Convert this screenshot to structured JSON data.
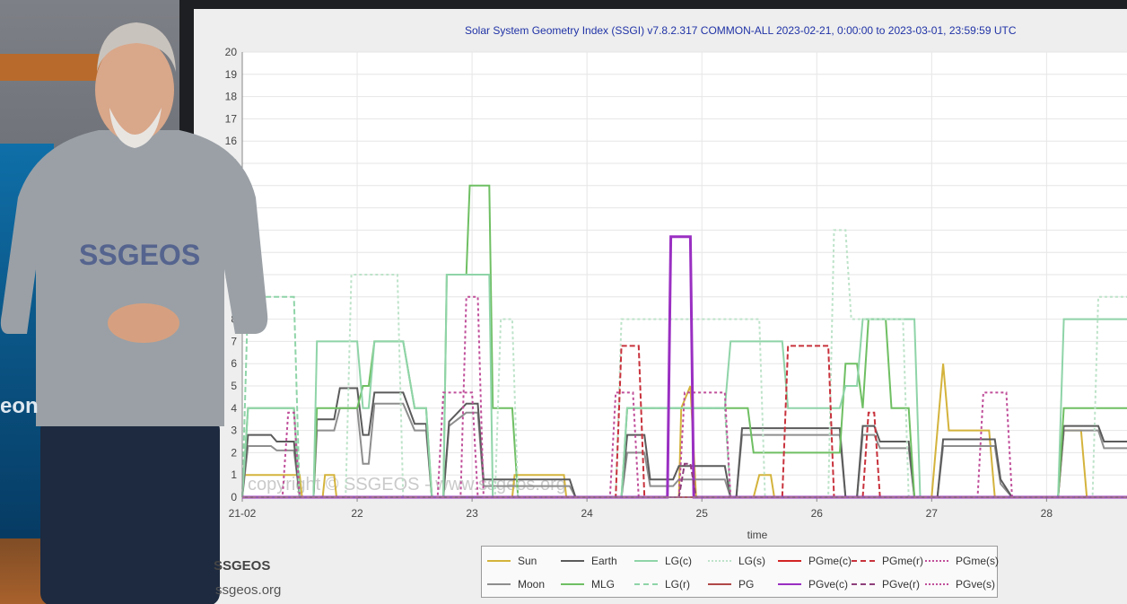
{
  "footer": {
    "name": "SSGEOS",
    "site": "ssgeos.org"
  },
  "shirt_logo": "SSGEOS",
  "side_screen_text": "eon",
  "chart_data": {
    "type": "line",
    "title": "Solar System Geometry Index (SSGI) v7.8.2.317 COMMON-ALL 2023-02-21,  0:00:00 to 2023-03-01, 23:59:59 UTC",
    "xlabel": "time",
    "ylabel": "",
    "x_tick_labels": [
      "21-02",
      "22",
      "23",
      "24",
      "25",
      "26",
      "27",
      "28"
    ],
    "x_tick_values": [
      0,
      1,
      2,
      3,
      4,
      5,
      6,
      7
    ],
    "xlim": [
      0,
      7.7
    ],
    "ylim": [
      0,
      20
    ],
    "y_ticks": [
      0,
      1,
      2,
      3,
      4,
      5,
      6,
      7,
      8,
      9,
      10,
      11,
      12,
      13,
      14,
      15,
      16,
      17,
      18,
      19,
      20
    ],
    "grid": true,
    "watermark": "copyright © SSGEOS - www.ssgeos.org",
    "legend_position": "bottom",
    "series": [
      {
        "name": "Sun",
        "color": "#d4b33c",
        "dash": "solid",
        "points": [
          [
            0,
            1
          ],
          [
            0.5,
            1
          ],
          [
            0.52,
            0
          ],
          [
            0.7,
            0
          ],
          [
            0.72,
            1
          ],
          [
            0.8,
            1
          ],
          [
            0.82,
            0
          ],
          [
            2.35,
            0
          ],
          [
            2.37,
            1
          ],
          [
            2.8,
            1
          ],
          [
            2.82,
            0
          ],
          [
            3.8,
            0
          ],
          [
            3.82,
            4
          ],
          [
            3.9,
            5
          ],
          [
            3.95,
            0
          ],
          [
            4.45,
            0
          ],
          [
            4.5,
            1
          ],
          [
            4.6,
            1
          ],
          [
            4.63,
            0
          ],
          [
            6.0,
            0
          ],
          [
            6.05,
            3
          ],
          [
            6.1,
            6
          ],
          [
            6.15,
            3
          ],
          [
            6.5,
            3
          ],
          [
            6.55,
            0
          ],
          [
            7.1,
            0
          ],
          [
            7.15,
            3
          ],
          [
            7.3,
            3
          ],
          [
            7.35,
            0
          ],
          [
            7.7,
            0
          ]
        ]
      },
      {
        "name": "Moon",
        "color": "#8e8e8e",
        "dash": "solid",
        "points": [
          [
            0,
            0
          ],
          [
            0.05,
            2.3
          ],
          [
            0.25,
            2.3
          ],
          [
            0.3,
            2.1
          ],
          [
            0.45,
            2.1
          ],
          [
            0.5,
            0
          ],
          [
            0.62,
            0
          ],
          [
            0.65,
            3
          ],
          [
            0.8,
            3
          ],
          [
            0.85,
            4
          ],
          [
            1.0,
            4
          ],
          [
            1.05,
            1.5
          ],
          [
            1.1,
            1.5
          ],
          [
            1.15,
            4.2
          ],
          [
            1.4,
            4.2
          ],
          [
            1.5,
            3
          ],
          [
            1.6,
            3
          ],
          [
            1.65,
            0
          ],
          [
            1.75,
            0
          ],
          [
            1.8,
            3.2
          ],
          [
            1.95,
            3.8
          ],
          [
            2.05,
            3.8
          ],
          [
            2.1,
            0.5
          ],
          [
            2.85,
            0.5
          ],
          [
            2.9,
            0
          ],
          [
            3.3,
            0
          ],
          [
            3.35,
            2
          ],
          [
            3.5,
            2
          ],
          [
            3.55,
            0.5
          ],
          [
            3.75,
            0.5
          ],
          [
            3.8,
            0.8
          ],
          [
            4.2,
            0.8
          ],
          [
            4.25,
            0
          ],
          [
            4.3,
            0
          ],
          [
            4.35,
            2.8
          ],
          [
            5.2,
            2.8
          ],
          [
            5.25,
            0
          ],
          [
            5.35,
            0
          ],
          [
            5.4,
            2.8
          ],
          [
            5.5,
            2.8
          ],
          [
            5.55,
            2.2
          ],
          [
            5.8,
            2.2
          ],
          [
            5.85,
            0
          ],
          [
            6.05,
            0
          ],
          [
            6.1,
            2.3
          ],
          [
            6.55,
            2.3
          ],
          [
            6.6,
            0.6
          ],
          [
            6.7,
            0
          ],
          [
            7.1,
            0
          ],
          [
            7.15,
            3
          ],
          [
            7.45,
            3
          ],
          [
            7.5,
            2.2
          ],
          [
            7.7,
            2.2
          ]
        ]
      },
      {
        "name": "Earth",
        "color": "#5b5b5b",
        "dash": "solid",
        "points": [
          [
            0,
            0
          ],
          [
            0.05,
            2.8
          ],
          [
            0.25,
            2.8
          ],
          [
            0.3,
            2.5
          ],
          [
            0.45,
            2.5
          ],
          [
            0.5,
            0
          ],
          [
            0.62,
            0
          ],
          [
            0.65,
            3.5
          ],
          [
            0.8,
            3.5
          ],
          [
            0.85,
            4.9
          ],
          [
            1.0,
            4.9
          ],
          [
            1.05,
            2.8
          ],
          [
            1.1,
            2.8
          ],
          [
            1.15,
            4.7
          ],
          [
            1.4,
            4.7
          ],
          [
            1.5,
            3.3
          ],
          [
            1.6,
            3.3
          ],
          [
            1.65,
            0
          ],
          [
            1.75,
            0
          ],
          [
            1.8,
            3.4
          ],
          [
            1.95,
            4.2
          ],
          [
            2.05,
            4.2
          ],
          [
            2.1,
            0.8
          ],
          [
            2.85,
            0.8
          ],
          [
            2.9,
            0
          ],
          [
            3.3,
            0
          ],
          [
            3.35,
            2.8
          ],
          [
            3.5,
            2.8
          ],
          [
            3.55,
            0.8
          ],
          [
            3.75,
            0.8
          ],
          [
            3.8,
            1.4
          ],
          [
            4.2,
            1.4
          ],
          [
            4.25,
            0
          ],
          [
            4.3,
            0
          ],
          [
            4.35,
            3.1
          ],
          [
            5.2,
            3.1
          ],
          [
            5.25,
            0
          ],
          [
            5.35,
            0
          ],
          [
            5.4,
            3.2
          ],
          [
            5.5,
            3.2
          ],
          [
            5.55,
            2.5
          ],
          [
            5.8,
            2.5
          ],
          [
            5.85,
            0
          ],
          [
            6.05,
            0
          ],
          [
            6.1,
            2.6
          ],
          [
            6.55,
            2.6
          ],
          [
            6.6,
            0.8
          ],
          [
            6.7,
            0
          ],
          [
            7.1,
            0
          ],
          [
            7.15,
            3.2
          ],
          [
            7.45,
            3.2
          ],
          [
            7.5,
            2.5
          ],
          [
            7.7,
            2.5
          ]
        ]
      },
      {
        "name": "MLG",
        "color": "#6fbf63",
        "dash": "solid",
        "points": [
          [
            0,
            0
          ],
          [
            0.05,
            4
          ],
          [
            0.45,
            4
          ],
          [
            0.5,
            0
          ],
          [
            0.62,
            0
          ],
          [
            0.65,
            4
          ],
          [
            1.0,
            4
          ],
          [
            1.05,
            5
          ],
          [
            1.1,
            5
          ],
          [
            1.15,
            7
          ],
          [
            1.4,
            7
          ],
          [
            1.5,
            4
          ],
          [
            1.6,
            4
          ],
          [
            1.65,
            0
          ],
          [
            1.75,
            0
          ],
          [
            1.78,
            10
          ],
          [
            1.95,
            10
          ],
          [
            1.98,
            14
          ],
          [
            2.15,
            14
          ],
          [
            2.18,
            4
          ],
          [
            2.35,
            4
          ],
          [
            2.4,
            0
          ],
          [
            3.3,
            0
          ],
          [
            3.35,
            4
          ],
          [
            4.4,
            4
          ],
          [
            4.45,
            2
          ],
          [
            5.2,
            2
          ],
          [
            5.25,
            6
          ],
          [
            5.35,
            6
          ],
          [
            5.4,
            4
          ],
          [
            5.45,
            8
          ],
          [
            5.6,
            8
          ],
          [
            5.65,
            4
          ],
          [
            5.8,
            4
          ],
          [
            5.85,
            0
          ],
          [
            7.1,
            0
          ],
          [
            7.15,
            4
          ],
          [
            7.7,
            4
          ]
        ]
      },
      {
        "name": "LG(c)",
        "color": "#8fd4a8",
        "dash": "solid",
        "points": [
          [
            0,
            0
          ],
          [
            0.05,
            4
          ],
          [
            0.45,
            4
          ],
          [
            0.5,
            0
          ],
          [
            0.62,
            0
          ],
          [
            0.65,
            7
          ],
          [
            1.0,
            7
          ],
          [
            1.05,
            4
          ],
          [
            1.1,
            4
          ],
          [
            1.15,
            7
          ],
          [
            1.4,
            7
          ],
          [
            1.5,
            4
          ],
          [
            1.6,
            4
          ],
          [
            1.65,
            0
          ],
          [
            1.75,
            0
          ],
          [
            1.78,
            10
          ],
          [
            2.15,
            10
          ],
          [
            2.18,
            0
          ],
          [
            3.3,
            0
          ],
          [
            3.35,
            4
          ],
          [
            4.2,
            4
          ],
          [
            4.25,
            7
          ],
          [
            4.7,
            7
          ],
          [
            4.75,
            4
          ],
          [
            5.2,
            4
          ],
          [
            5.25,
            5
          ],
          [
            5.35,
            5
          ],
          [
            5.4,
            8
          ],
          [
            5.85,
            8
          ],
          [
            5.9,
            0
          ],
          [
            7.1,
            0
          ],
          [
            7.15,
            8
          ],
          [
            7.7,
            8
          ]
        ]
      },
      {
        "name": "LG(r)",
        "color": "#8fd4a8",
        "dash": "6,3",
        "points": [
          [
            0,
            0
          ],
          [
            0.05,
            9
          ],
          [
            0.45,
            9
          ],
          [
            0.5,
            0
          ],
          [
            3.3,
            0
          ],
          [
            3.35,
            4
          ],
          [
            4.2,
            4
          ],
          [
            4.25,
            0
          ],
          [
            7.7,
            0
          ]
        ]
      },
      {
        "name": "LG(s)",
        "color": "#bde3c9",
        "dash": "3,3",
        "points": [
          [
            0,
            0
          ],
          [
            0.9,
            0
          ],
          [
            0.95,
            10
          ],
          [
            1.35,
            10
          ],
          [
            1.4,
            0
          ],
          [
            2.2,
            0
          ],
          [
            2.25,
            8
          ],
          [
            2.35,
            8
          ],
          [
            2.4,
            0
          ],
          [
            3.25,
            0
          ],
          [
            3.3,
            8
          ],
          [
            4.5,
            8
          ],
          [
            4.55,
            0
          ],
          [
            5.1,
            0
          ],
          [
            5.15,
            12
          ],
          [
            5.25,
            12
          ],
          [
            5.3,
            8
          ],
          [
            5.75,
            8
          ],
          [
            5.8,
            0
          ],
          [
            7.4,
            0
          ],
          [
            7.45,
            9
          ],
          [
            7.7,
            9
          ]
        ]
      },
      {
        "name": "PG",
        "color": "#b04848",
        "dash": "solid",
        "points": [
          [
            0,
            0
          ],
          [
            7.7,
            0
          ]
        ]
      },
      {
        "name": "PGme(c)",
        "color": "#d22424",
        "dash": "solid",
        "points": [
          [
            0,
            0
          ],
          [
            7.7,
            0
          ]
        ]
      },
      {
        "name": "PGme(r)",
        "color": "#c8323c",
        "dash": "6,3",
        "points": [
          [
            0,
            0
          ],
          [
            3.25,
            0
          ],
          [
            3.3,
            6.8
          ],
          [
            3.45,
            6.8
          ],
          [
            3.5,
            0
          ],
          [
            4.7,
            0
          ],
          [
            4.75,
            6.8
          ],
          [
            5.1,
            6.8
          ],
          [
            5.15,
            0
          ],
          [
            5.4,
            0
          ],
          [
            5.45,
            3.8
          ],
          [
            5.5,
            3.8
          ],
          [
            5.55,
            0
          ],
          [
            7.7,
            0
          ]
        ]
      },
      {
        "name": "PGme(s)",
        "color": "#c04f9a",
        "dash": "3,3",
        "points": [
          [
            0,
            0
          ],
          [
            0.35,
            0
          ],
          [
            0.4,
            3.8
          ],
          [
            0.45,
            3.8
          ],
          [
            0.5,
            0
          ],
          [
            1.7,
            0
          ],
          [
            1.75,
            4.7
          ],
          [
            2.0,
            4.7
          ],
          [
            2.05,
            0
          ],
          [
            3.2,
            0
          ],
          [
            3.25,
            4.7
          ],
          [
            3.4,
            4.7
          ],
          [
            3.45,
            0
          ],
          [
            3.8,
            0
          ],
          [
            3.85,
            4.7
          ],
          [
            4.2,
            4.7
          ],
          [
            4.25,
            0
          ],
          [
            6.4,
            0
          ],
          [
            6.45,
            4.7
          ],
          [
            6.65,
            4.7
          ],
          [
            6.7,
            0
          ],
          [
            7.7,
            0
          ]
        ]
      },
      {
        "name": "PGve(c)",
        "color": "#9a2fc2",
        "dash": "solid",
        "points": [
          [
            0,
            0
          ],
          [
            3.7,
            0
          ],
          [
            3.73,
            11.7
          ],
          [
            3.9,
            11.7
          ],
          [
            3.93,
            0
          ],
          [
            7.7,
            0
          ]
        ]
      },
      {
        "name": "PGve(r)",
        "color": "#8e3f7b",
        "dash": "6,3",
        "points": [
          [
            0,
            0
          ],
          [
            3.8,
            0
          ],
          [
            3.85,
            1.5
          ],
          [
            3.9,
            1.5
          ],
          [
            3.95,
            0
          ],
          [
            7.7,
            0
          ]
        ]
      },
      {
        "name": "PGve(s)",
        "color": "#c04f9a",
        "dash": "3,3",
        "points": [
          [
            0,
            0
          ],
          [
            1.9,
            0
          ],
          [
            1.95,
            9
          ],
          [
            2.05,
            9
          ],
          [
            2.1,
            0
          ],
          [
            7.7,
            0
          ]
        ]
      }
    ]
  }
}
